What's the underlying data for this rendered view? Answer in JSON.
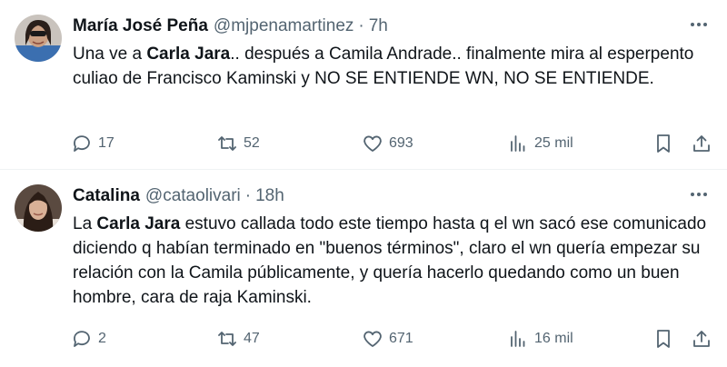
{
  "tweets": [
    {
      "name": "María José Peña",
      "handle": "@mjpenamartinez",
      "separator": "·",
      "time": "7h",
      "text_parts": [
        "Una ve a ",
        "Carla Jara",
        ".. después a Camila Andrade.. finalmente mira al esperpento culiao de Francisco Kaminski y NO SE ENTIENDE WN, NO SE ENTIENDE."
      ],
      "replies": "17",
      "reposts": "52",
      "likes": "693",
      "views": "25 mil"
    },
    {
      "name": "Catalina",
      "handle": "@cataolivari",
      "separator": "·",
      "time": "18h",
      "text_parts": [
        "La ",
        "Carla Jara",
        " estuvo callada todo este tiempo hasta q el wn sacó ese comunicado diciendo q habían terminado en \"buenos términos\", claro el wn quería empezar su relación con la Camila públicamente, y quería hacerlo quedando como un buen hombre, cara de raja Kaminski."
      ],
      "replies": "2",
      "reposts": "47",
      "likes": "671",
      "views": "16 mil"
    }
  ],
  "icons": {
    "reply": "reply-icon",
    "repost": "repost-icon",
    "like": "heart-icon",
    "views": "analytics-icon",
    "bookmark": "bookmark-icon",
    "share": "share-icon",
    "more": "more-icon"
  },
  "colors": {
    "text": "#0f1419",
    "secondary": "#536471",
    "divider": "#eff3f4"
  }
}
